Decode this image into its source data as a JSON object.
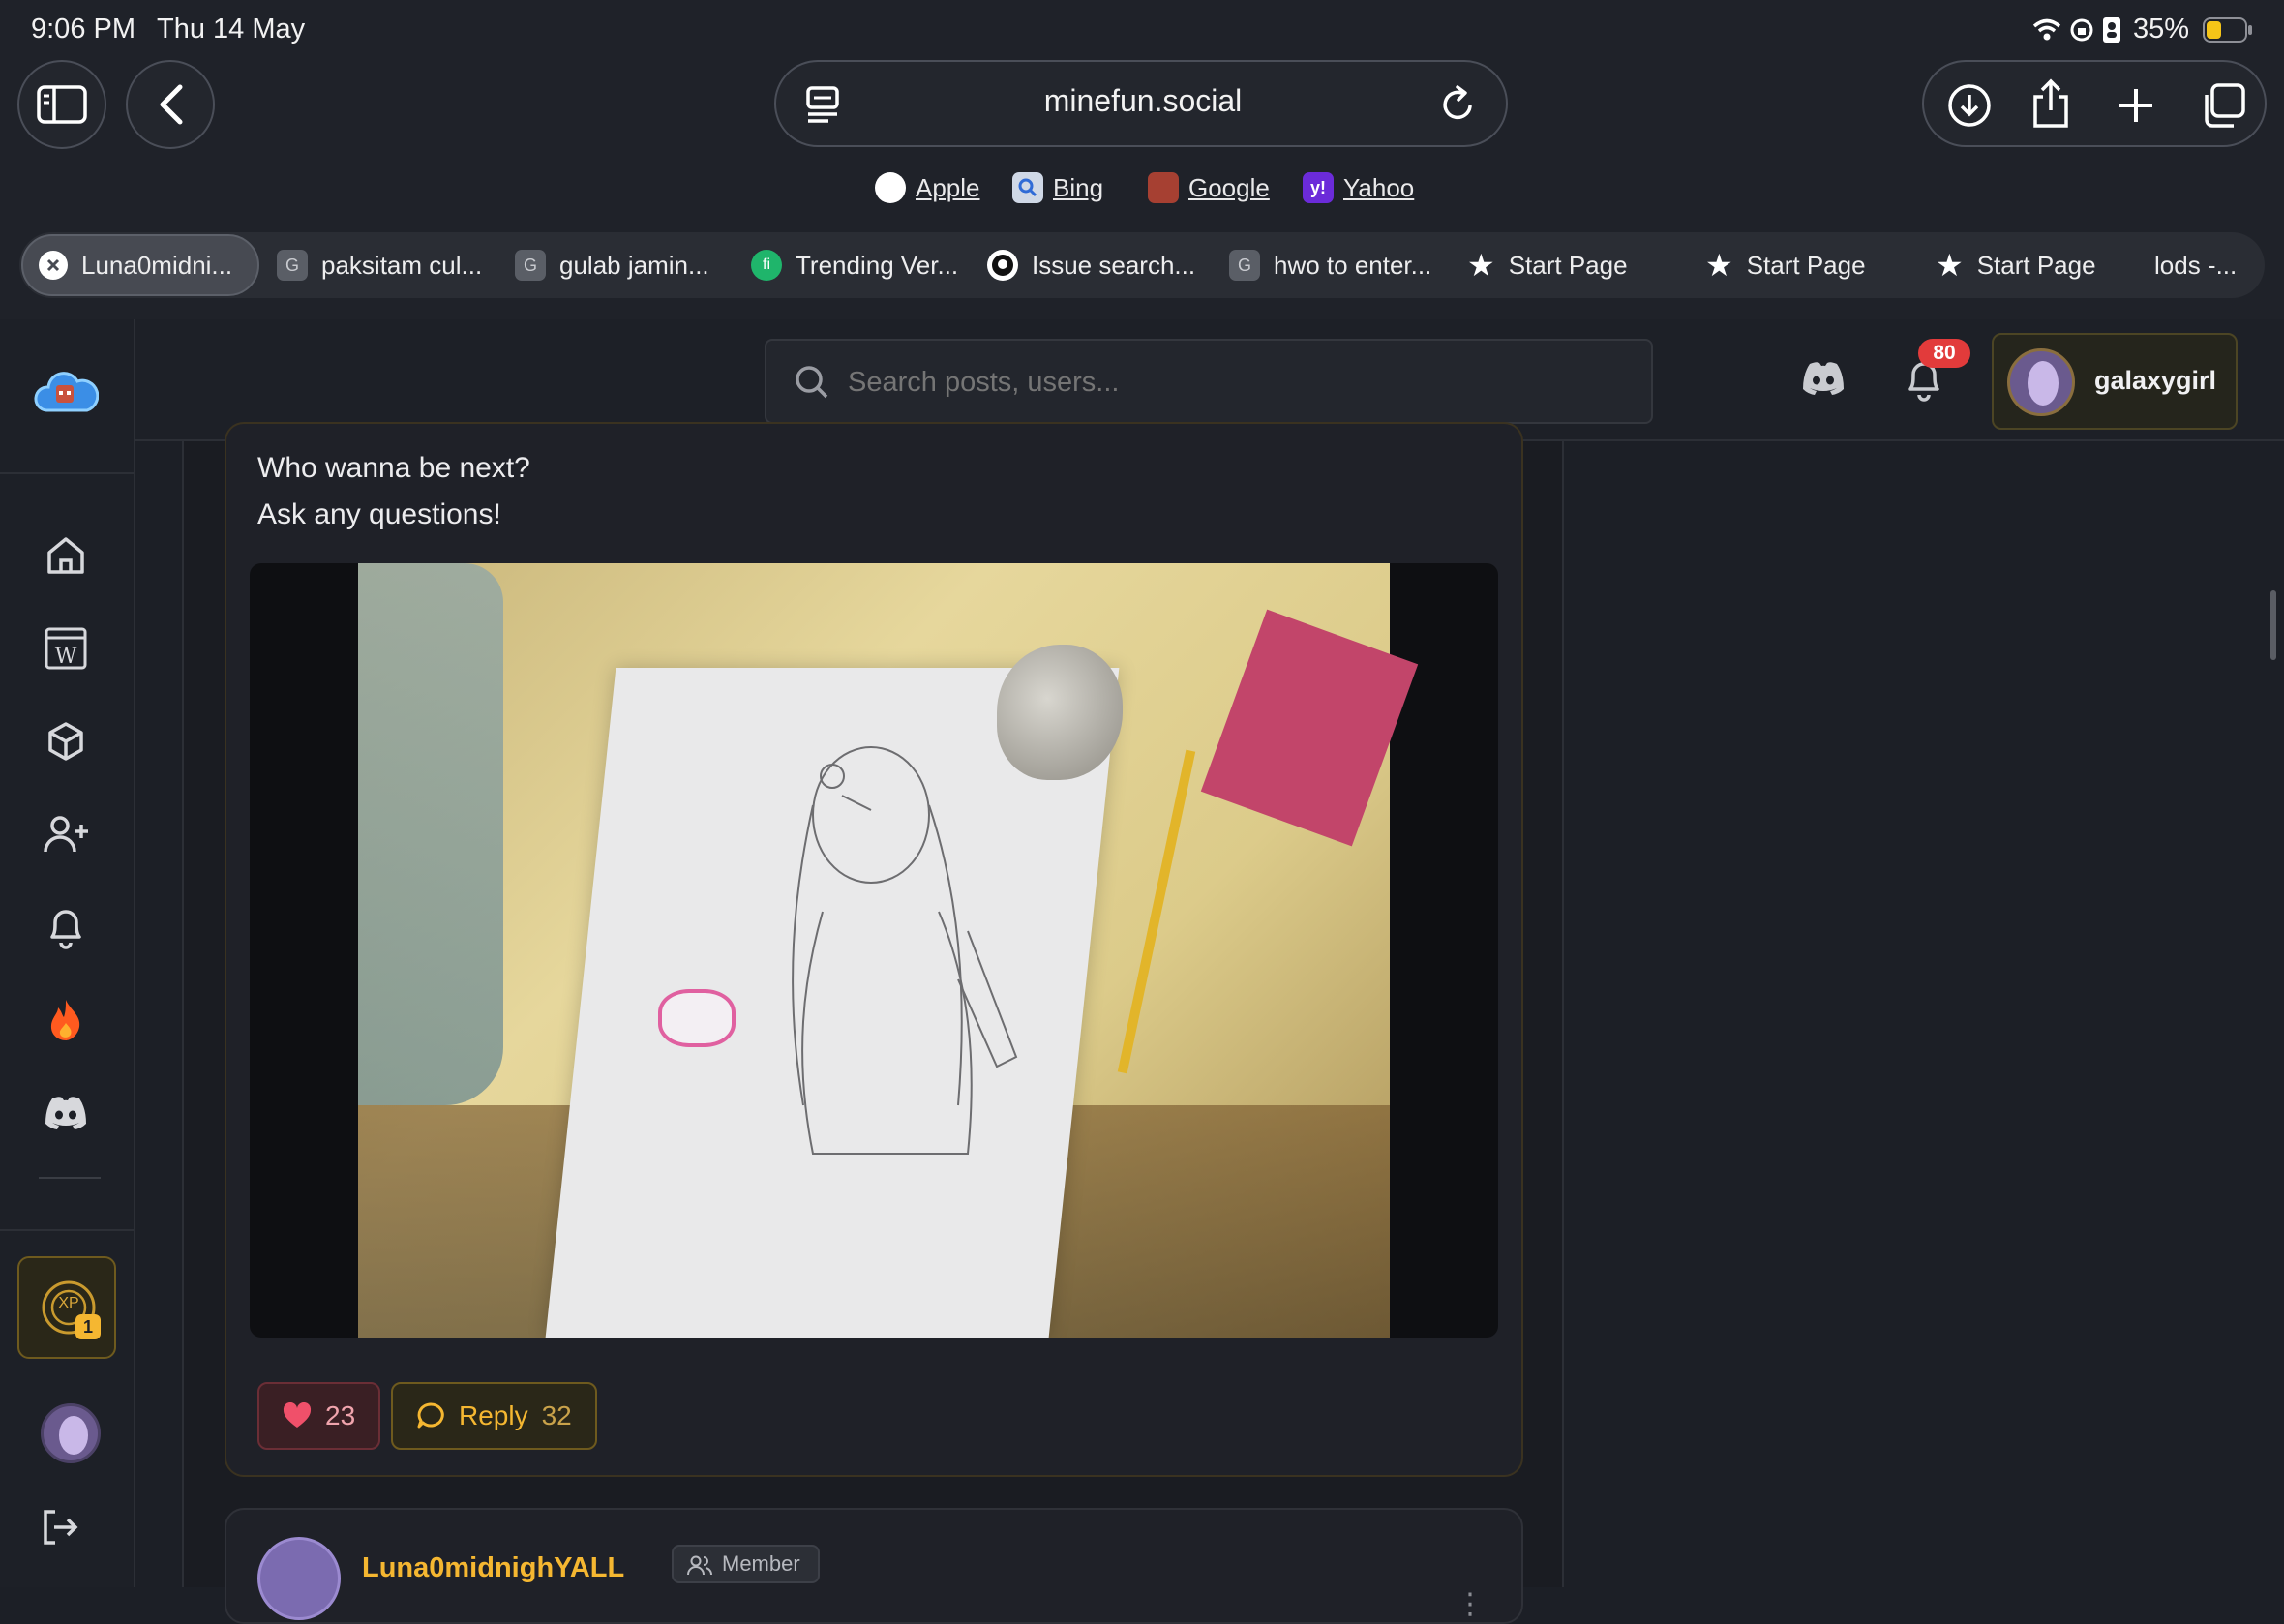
{
  "status_bar": {
    "time": "9:06 PM",
    "date": "Thu 14 May",
    "battery": "35%",
    "battery_color": "#f5c518"
  },
  "browser": {
    "url": "minefun.social",
    "favorites": [
      {
        "label": "Apple",
        "icon": "apple-icon"
      },
      {
        "label": "Bing",
        "icon": "bing-icon"
      },
      {
        "label": "Google",
        "icon": "google-icon"
      },
      {
        "label": "Yahoo",
        "icon": "yahoo-icon"
      }
    ],
    "tabs": [
      {
        "label": "Luna0midni...",
        "icon": "close-icon",
        "active": true
      },
      {
        "label": "paksitam cul...",
        "icon": "G"
      },
      {
        "label": "gulab jamin...",
        "icon": "G"
      },
      {
        "label": "Trending Ver...",
        "icon": "fi"
      },
      {
        "label": "Issue search...",
        "icon": "github-icon"
      },
      {
        "label": "hwo to enter...",
        "icon": "G"
      },
      {
        "label": "Start Page",
        "icon": "star-icon"
      },
      {
        "label": "Start Page",
        "icon": "star-icon"
      },
      {
        "label": "Start Page",
        "icon": "star-icon"
      },
      {
        "label": "lods -...",
        "icon": ""
      }
    ]
  },
  "app": {
    "search_placeholder": "Search posts, users...",
    "notification_count": "80",
    "username": "galaxygirl",
    "xp_level": "1",
    "xp_label": "XP",
    "accent": "#f5b731",
    "sidebar_icons": [
      "home-icon",
      "wiki-icon",
      "cube-icon",
      "add-user-icon",
      "bell-icon",
      "fire-icon",
      "discord-icon"
    ]
  },
  "post": {
    "lines": [
      "Who wanna be next?",
      "Ask any questions!"
    ],
    "likes": "23",
    "reply_label": "Reply",
    "reply_count": "32"
  },
  "next_post": {
    "author": "Luna0midnighYALL",
    "role": "Member"
  }
}
